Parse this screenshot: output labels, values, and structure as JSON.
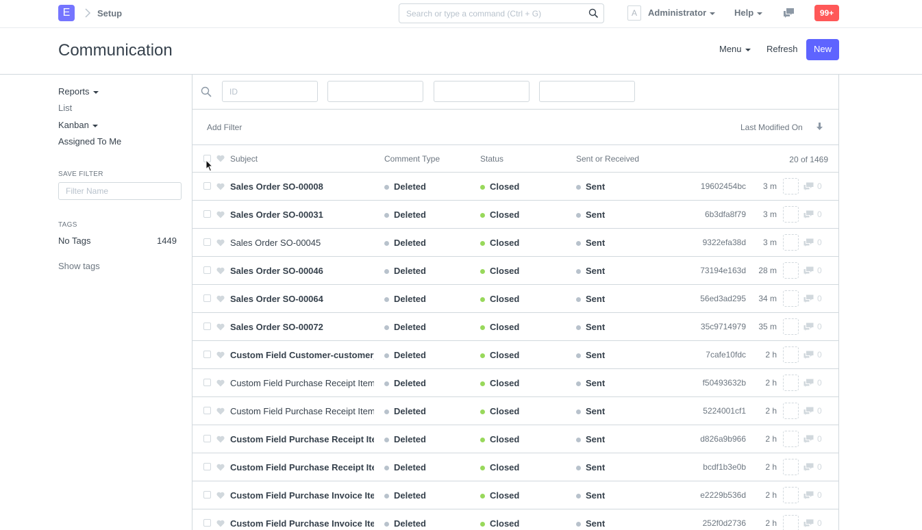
{
  "navbar": {
    "logo_letter": "E",
    "breadcrumb": "Setup",
    "search_placeholder": "Search or type a command (Ctrl + G)",
    "avatar_letter": "A",
    "user_label": "Administrator",
    "help_label": "Help",
    "notification_count": "99+",
    "icons": [
      "chevron-right-icon",
      "search-icon",
      "chat-icon"
    ]
  },
  "page": {
    "title": "Communication",
    "menu_label": "Menu",
    "refresh_label": "Refresh",
    "new_label": "New",
    "primary_color": "#5e64ff"
  },
  "sidebar": {
    "reports_label": "Reports",
    "list_label": "List",
    "kanban_label": "Kanban",
    "assigned_label": "Assigned To Me",
    "save_filter_heading": "SAVE FILTER",
    "filter_name_placeholder": "Filter Name",
    "tags_heading": "TAGS",
    "no_tags_label": "No Tags",
    "no_tags_count": "1449",
    "show_tags_label": "Show tags"
  },
  "filters": {
    "id_placeholder": "ID",
    "add_filter_label": "Add Filter",
    "sort_label": "Last Modified On"
  },
  "list": {
    "headers": {
      "subject": "Subject",
      "comment_type": "Comment Type",
      "status": "Status",
      "sent_or_received": "Sent or Received",
      "count": "20 of 1469"
    },
    "status_colors": {
      "Deleted": "#b8c2cc",
      "Closed": "#98d85b",
      "Sent": "#b8c2cc"
    },
    "rows": [
      {
        "subject": "Sales Order SO-00008",
        "bold": true,
        "comment_type": "Deleted",
        "status": "Closed",
        "sent": "Sent",
        "name": "19602454bc",
        "ago": "3 m",
        "comments": "0"
      },
      {
        "subject": "Sales Order SO-00031",
        "bold": true,
        "comment_type": "Deleted",
        "status": "Closed",
        "sent": "Sent",
        "name": "6b3dfa8f79",
        "ago": "3 m",
        "comments": "0"
      },
      {
        "subject": "Sales Order SO-00045",
        "bold": false,
        "comment_type": "Deleted",
        "status": "Closed",
        "sent": "Sent",
        "name": "9322efa38d",
        "ago": "3 m",
        "comments": "0"
      },
      {
        "subject": "Sales Order SO-00046",
        "bold": true,
        "comment_type": "Deleted",
        "status": "Closed",
        "sent": "Sent",
        "name": "73194e163d",
        "ago": "28 m",
        "comments": "0"
      },
      {
        "subject": "Sales Order SO-00064",
        "bold": true,
        "comment_type": "Deleted",
        "status": "Closed",
        "sent": "Sent",
        "name": "56ed3ad295",
        "ago": "34 m",
        "comments": "0"
      },
      {
        "subject": "Sales Order SO-00072",
        "bold": true,
        "comment_type": "Deleted",
        "status": "Closed",
        "sent": "Sent",
        "name": "35c9714979",
        "ago": "35 m",
        "comments": "0"
      },
      {
        "subject": "Custom Field Customer-customer_i",
        "bold": true,
        "comment_type": "Deleted",
        "status": "Closed",
        "sent": "Sent",
        "name": "7cafe10fdc",
        "ago": "2 h",
        "comments": "0"
      },
      {
        "subject": "Custom Field Purchase Receipt Item-",
        "bold": false,
        "comment_type": "Deleted",
        "status": "Closed",
        "sent": "Sent",
        "name": "f50493632b",
        "ago": "2 h",
        "comments": "0"
      },
      {
        "subject": "Custom Field Purchase Receipt Item-",
        "bold": false,
        "comment_type": "Deleted",
        "status": "Closed",
        "sent": "Sent",
        "name": "5224001cf1",
        "ago": "2 h",
        "comments": "0"
      },
      {
        "subject": "Custom Field Purchase Receipt Iter",
        "bold": true,
        "comment_type": "Deleted",
        "status": "Closed",
        "sent": "Sent",
        "name": "d826a9b966",
        "ago": "2 h",
        "comments": "0"
      },
      {
        "subject": "Custom Field Purchase Receipt Iter",
        "bold": true,
        "comment_type": "Deleted",
        "status": "Closed",
        "sent": "Sent",
        "name": "bcdf1b3e0b",
        "ago": "2 h",
        "comments": "0"
      },
      {
        "subject": "Custom Field Purchase Invoice Item",
        "bold": true,
        "comment_type": "Deleted",
        "status": "Closed",
        "sent": "Sent",
        "name": "e2229b536d",
        "ago": "2 h",
        "comments": "0"
      },
      {
        "subject": "Custom Field Purchase Invoice Item",
        "bold": true,
        "comment_type": "Deleted",
        "status": "Closed",
        "sent": "Sent",
        "name": "252f0d2736",
        "ago": "2 h",
        "comments": "0"
      }
    ]
  }
}
